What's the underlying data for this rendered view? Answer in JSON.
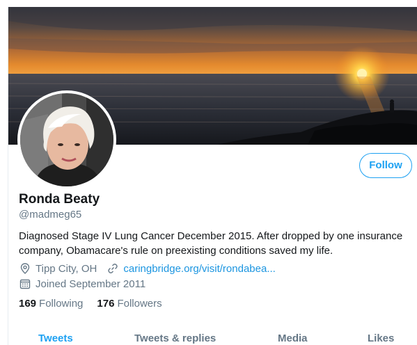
{
  "profile": {
    "name": "Ronda Beaty",
    "handle": "@madmeg65",
    "bio": "Diagnosed Stage IV Lung Cancer December 2015. After dropped by one insurance company, Obamacare's rule on preexisting conditions saved my life.",
    "location": "Tipp City, OH",
    "website": "caringbridge.org/visit/rondabea...",
    "joined": "Joined September 2011"
  },
  "actions": {
    "follow_label": "Follow"
  },
  "stats": {
    "following_count": "169",
    "following_label": "Following",
    "followers_count": "176",
    "followers_label": "Followers"
  },
  "tabs": [
    {
      "label": "Tweets",
      "active": true
    },
    {
      "label": "Tweets & replies",
      "active": false
    },
    {
      "label": "Media",
      "active": false
    },
    {
      "label": "Likes",
      "active": false
    }
  ],
  "colors": {
    "accent": "#1da1f2",
    "link": "#1b95e0",
    "secondary_text": "#657786",
    "primary_text": "#14171a"
  },
  "icons": [
    "location-pin-icon",
    "link-icon",
    "calendar-icon"
  ]
}
